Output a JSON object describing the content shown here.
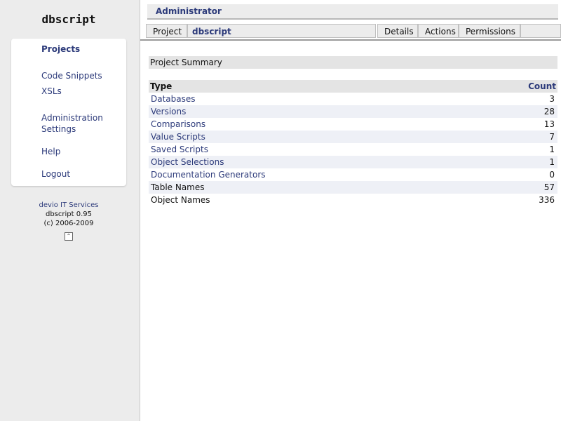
{
  "app": {
    "logo_text": "dbscript"
  },
  "sidebar": {
    "nav": [
      {
        "label": "Projects"
      },
      {
        "label": "Code Snippets"
      },
      {
        "label": "XSLs"
      },
      {
        "label": "Administration Settings"
      },
      {
        "label": "Help"
      },
      {
        "label": "Logout"
      }
    ],
    "footer": {
      "vendor": "devio IT Services",
      "version": "dbscript 0.95",
      "copyright": "(c) 2006-2009",
      "top_icon": "scroll-to-top-icon"
    }
  },
  "header": {
    "user": "Administrator"
  },
  "tabs": {
    "project": "Project",
    "project_name": "dbscript",
    "details": "Details",
    "actions": "Actions",
    "permissions": "Permissions"
  },
  "summary": {
    "title": "Project Summary",
    "col_type": "Type",
    "col_count": "Count",
    "rows": [
      {
        "type": "Databases",
        "count": "3"
      },
      {
        "type": "Versions",
        "count": "28"
      },
      {
        "type": "Comparisons",
        "count": "13"
      },
      {
        "type": "Value Scripts",
        "count": "7"
      },
      {
        "type": "Saved Scripts",
        "count": "1"
      },
      {
        "type": "Object Selections",
        "count": "1"
      },
      {
        "type": "Documentation Generators",
        "count": "0"
      },
      {
        "type": "Table Names",
        "count": "57"
      },
      {
        "type": "Object Names",
        "count": "336"
      }
    ]
  },
  "colors": {
    "link": "#2c3a7a",
    "background": "#ececec",
    "row_alt": "#eef0f6"
  }
}
